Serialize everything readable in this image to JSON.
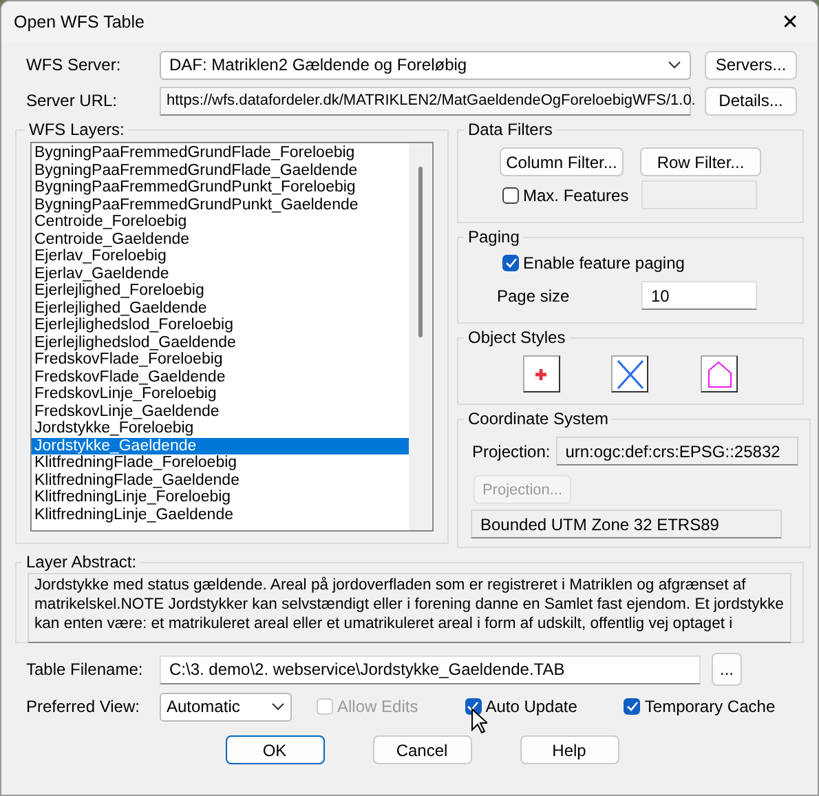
{
  "window": {
    "title": "Open WFS Table",
    "close": "✕"
  },
  "server": {
    "label": "WFS Server:",
    "value": "DAF: Matriklen2 Gældende og Foreløbig",
    "button": "Servers..."
  },
  "server_url": {
    "label": "Server URL:",
    "value": "https://wfs.datafordeler.dk/MATRIKLEN2/MatGaeldendeOgForeloebigWFS/1.0.",
    "button": "Details..."
  },
  "layers": {
    "title": "WFS Layers:",
    "items": [
      {
        "label": "BygningPaaFremmedGrundFlade_Foreloebig",
        "selected": false
      },
      {
        "label": "BygningPaaFremmedGrundFlade_Gaeldende",
        "selected": false
      },
      {
        "label": "BygningPaaFremmedGrundPunkt_Foreloebig",
        "selected": false
      },
      {
        "label": "BygningPaaFremmedGrundPunkt_Gaeldende",
        "selected": false
      },
      {
        "label": "Centroide_Foreloebig",
        "selected": false
      },
      {
        "label": "Centroide_Gaeldende",
        "selected": false
      },
      {
        "label": "Ejerlav_Foreloebig",
        "selected": false
      },
      {
        "label": "Ejerlav_Gaeldende",
        "selected": false
      },
      {
        "label": "Ejerlejlighed_Foreloebig",
        "selected": false
      },
      {
        "label": "Ejerlejlighed_Gaeldende",
        "selected": false
      },
      {
        "label": "Ejerlejlighedslod_Foreloebig",
        "selected": false
      },
      {
        "label": "Ejerlejlighedslod_Gaeldende",
        "selected": false
      },
      {
        "label": "FredskovFlade_Foreloebig",
        "selected": false
      },
      {
        "label": "FredskovFlade_Gaeldende",
        "selected": false
      },
      {
        "label": "FredskovLinje_Foreloebig",
        "selected": false
      },
      {
        "label": "FredskovLinje_Gaeldende",
        "selected": false
      },
      {
        "label": "Jordstykke_Foreloebig",
        "selected": false
      },
      {
        "label": "Jordstykke_Gaeldende",
        "selected": true
      },
      {
        "label": "KlitfredningFlade_Foreloebig",
        "selected": false
      },
      {
        "label": "KlitfredningFlade_Gaeldende",
        "selected": false
      },
      {
        "label": "KlitfredningLinje_Foreloebig",
        "selected": false
      },
      {
        "label": "KlitfredningLinje_Gaeldende",
        "selected": false
      }
    ]
  },
  "data_filters": {
    "title": "Data Filters",
    "column_filter": "Column Filter...",
    "row_filter": "Row Filter...",
    "max_features": {
      "label": "Max. Features",
      "checked": false
    }
  },
  "paging": {
    "title": "Paging",
    "enable": {
      "label": "Enable feature paging",
      "checked": true
    },
    "page_size_label": "Page size",
    "page_size": "10"
  },
  "object_styles": {
    "title": "Object Styles",
    "items": [
      {
        "kind": "symbol"
      },
      {
        "kind": "line"
      },
      {
        "kind": "region"
      }
    ]
  },
  "coordinate_system": {
    "title": "Coordinate System",
    "projection_label": "Projection:",
    "projection": "urn:ogc:def:crs:EPSG::25832",
    "projection_button": {
      "label": "Projection...",
      "disabled": true
    },
    "description": "Bounded UTM Zone 32 ETRS89"
  },
  "layer_abstract": {
    "title": "Layer Abstract:",
    "text": "Jordstykke med status gældende. Areal på jordoverfladen som er registreret i Matriklen og afgrænset af matrikelskel.NOTE Jordstykker kan selvstændigt eller i forening danne en Samlet fast ejendom. Et jordstykke kan enten være: et matrikuleret areal eller et umatrikuleret areal i form af udskilt, offentlig vej optaget i"
  },
  "table_filename": {
    "label": "Table Filename:",
    "value": "C:\\3. demo\\2. webservice\\Jordstykke_Gaeldende.TAB",
    "button": "..."
  },
  "preferred_view": {
    "label": "Preferred View:",
    "value": "Automatic"
  },
  "options": [
    {
      "label": "Allow Edits",
      "checked": false,
      "disabled": true
    },
    {
      "label": "Auto Update",
      "checked": true,
      "disabled": false
    },
    {
      "label": "Temporary Cache",
      "checked": true,
      "disabled": false
    }
  ],
  "buttons": [
    {
      "label": "OK",
      "default": true
    },
    {
      "label": "Cancel",
      "default": false
    },
    {
      "label": "Help",
      "default": false
    }
  ]
}
